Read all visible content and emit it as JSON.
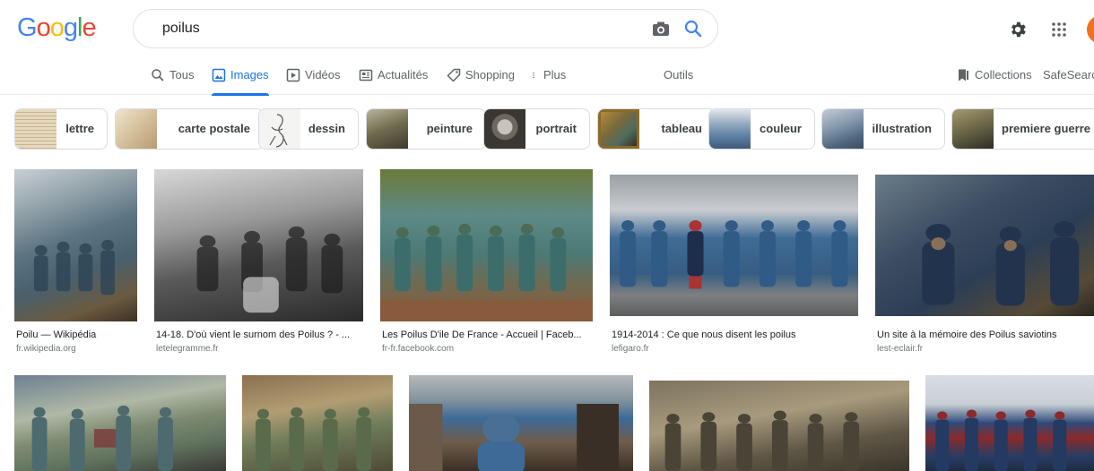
{
  "header": {
    "logo_letters": [
      "G",
      "o",
      "o",
      "g",
      "l",
      "e"
    ],
    "logo_colors": [
      "#4285f4",
      "#ea4335",
      "#fbbc05",
      "#4285f4",
      "#34a853",
      "#ea4335"
    ],
    "search_value": "poilus"
  },
  "tabs": [
    {
      "label": "Tous",
      "icon": "search-icon"
    },
    {
      "label": "Images",
      "icon": "image-icon",
      "active": true
    },
    {
      "label": "Vidéos",
      "icon": "video-icon"
    },
    {
      "label": "Actualités",
      "icon": "news-icon"
    },
    {
      "label": "Shopping",
      "icon": "tag-icon"
    },
    {
      "label": "Plus",
      "icon": "more-vert-icon"
    },
    {
      "label": "Outils"
    },
    {
      "label": "Collections",
      "icon": "bookmark-icon"
    },
    {
      "label": "SafeSearch"
    }
  ],
  "chips": [
    {
      "label": "lettre"
    },
    {
      "label": "carte postale"
    },
    {
      "label": "dessin"
    },
    {
      "label": "peinture"
    },
    {
      "label": "portrait"
    },
    {
      "label": "tableau"
    },
    {
      "label": "couleur"
    },
    {
      "label": "illustration"
    },
    {
      "label": "premiere guerre"
    }
  ],
  "results_row1": [
    {
      "title": "Poilu — Wikipédia",
      "source": "fr.wikipedia.org"
    },
    {
      "title": "14-18. D'où vient le surnom des Poilus ? - ...",
      "source": "letelegramme.fr"
    },
    {
      "title": "Les Poilus D'ile De France - Accueil | Faceb...",
      "source": "fr-fr.facebook.com"
    },
    {
      "title": "1914-2014 : Ce que nous disent les poilus",
      "source": "lefigaro.fr"
    },
    {
      "title": "Un site à la mémoire des Poilus saviotins",
      "source": "lest-eclair.fr"
    }
  ],
  "colors": {
    "accent": "#1a73e8",
    "tab_text": "#5f6368",
    "source_text": "#70757a",
    "avatar": "#f2711c"
  }
}
